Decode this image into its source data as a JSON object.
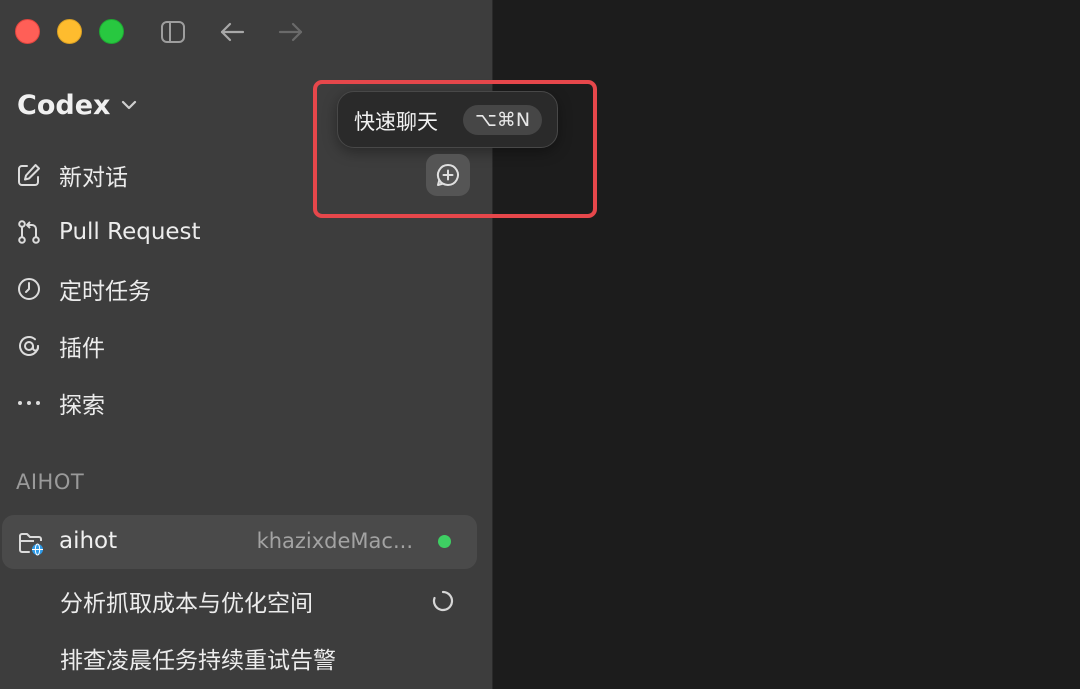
{
  "workspace": {
    "name": "Codex"
  },
  "nav": [
    {
      "label": "新对话",
      "icon": "edit-icon"
    },
    {
      "label": "Pull Request",
      "icon": "git-pull-request-icon"
    },
    {
      "label": "定时任务",
      "icon": "clock-icon"
    },
    {
      "label": "插件",
      "icon": "plugin-icon"
    },
    {
      "label": "探索",
      "icon": "more-dots-icon"
    }
  ],
  "section": {
    "label": "AIHOT"
  },
  "project": {
    "name": "aihot",
    "host": "khazixdeMac...",
    "status_color": "#3ecf63"
  },
  "threads": [
    {
      "label": "分析抓取成本与优化空间"
    },
    {
      "label": "排查凌晨任务持续重试告警"
    }
  ],
  "tooltip": {
    "label": "快速聊天",
    "shortcut": "⌥⌘N"
  },
  "colors": {
    "highlight": "#e6474b",
    "sidebar_bg": "#3d3d3d",
    "main_bg": "#1c1c1c"
  }
}
